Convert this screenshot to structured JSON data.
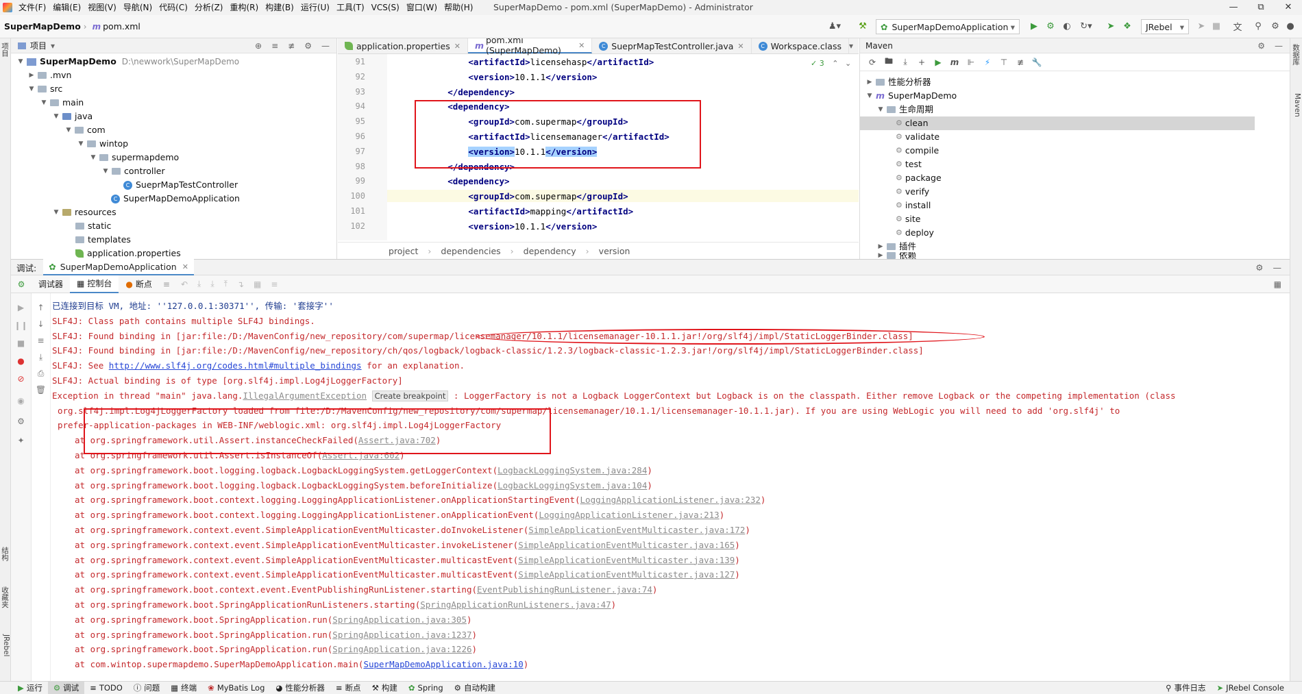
{
  "menubar": {
    "items": [
      "文件(F)",
      "编辑(E)",
      "视图(V)",
      "导航(N)",
      "代码(C)",
      "分析(Z)",
      "重构(R)",
      "构建(B)",
      "运行(U)",
      "工具(T)",
      "VCS(S)",
      "窗口(W)",
      "帮助(H)"
    ],
    "title": "SuperMapDemo - pom.xml (SuperMapDemo) - Administrator"
  },
  "navbar": {
    "project": "SuperMapDemo",
    "file": "pom.xml",
    "run_config": "SuperMapDemoApplication",
    "jrebel": "JRebel"
  },
  "left_stripe": {
    "project_tab": "项目",
    "structure_tab": "结构",
    "favorites_tab": "收藏夹",
    "jrebel_tab": "JRebel"
  },
  "right_stripe": {
    "db_tab": "数据库",
    "maven_tab": "Maven"
  },
  "project_panel": {
    "title": "项目",
    "root": "SuperMapDemo",
    "root_path": "D:\\newwork\\SuperMapDemo",
    "items": [
      ".mvn",
      "src",
      "main",
      "java",
      "com",
      "wintop",
      "supermapdemo",
      "controller",
      "SueprMapTestController",
      "SuperMapDemoApplication",
      "resources",
      "static",
      "templates",
      "application.properties"
    ]
  },
  "editor": {
    "tabs": [
      "application.properties",
      "pom.xml (SuperMapDemo)",
      "SueprMapTestController.java",
      "Workspace.class"
    ],
    "inspection_count": "3",
    "lines": [
      {
        "n": "91",
        "pre": "            ",
        "open": "<artifactId>",
        "text": "licensehasp",
        "close": "</artifactId>"
      },
      {
        "n": "92",
        "pre": "            ",
        "open": "<version>",
        "text": "10.1.1",
        "close": "</version>"
      },
      {
        "n": "93",
        "pre": "        ",
        "open": "</dependency>",
        "text": "",
        "close": ""
      },
      {
        "n": "94",
        "pre": "        ",
        "open": "<dependency>",
        "text": "",
        "close": ""
      },
      {
        "n": "95",
        "pre": "            ",
        "open": "<groupId>",
        "text": "com.supermap",
        "close": "</groupId>"
      },
      {
        "n": "96",
        "pre": "            ",
        "open": "<artifactId>",
        "text": "licensemanager",
        "close": "</artifactId>"
      },
      {
        "n": "97",
        "pre": "            ",
        "open": "<version>",
        "text": "10.1.1",
        "close": "</version>"
      },
      {
        "n": "98",
        "pre": "        ",
        "open": "</dependency>",
        "text": "",
        "close": ""
      },
      {
        "n": "99",
        "pre": "        ",
        "open": "<dependency>",
        "text": "",
        "close": ""
      },
      {
        "n": "100",
        "pre": "            ",
        "open": "<groupId>",
        "text": "com.supermap",
        "close": "</groupId>"
      },
      {
        "n": "101",
        "pre": "            ",
        "open": "<artifactId>",
        "text": "mapping",
        "close": "</artifactId>"
      },
      {
        "n": "102",
        "pre": "            ",
        "open": "<version>",
        "text": "10.1.1",
        "close": "</version>"
      }
    ],
    "breadcrumb": [
      "project",
      "dependencies",
      "dependency",
      "version"
    ]
  },
  "maven": {
    "title": "Maven",
    "nodes": {
      "profiles": "性能分析器",
      "project": "SuperMapDemo",
      "lifecycle": "生命周期",
      "phases": [
        "clean",
        "validate",
        "compile",
        "test",
        "package",
        "verify",
        "install",
        "site",
        "deploy"
      ],
      "plugins": "插件",
      "deps": "依赖"
    }
  },
  "debug": {
    "label": "调试:",
    "config": "SuperMapDemoApplication",
    "tabs": {
      "debugger": "调试器",
      "console": "控制台",
      "breakpoints": "断点"
    }
  },
  "console": {
    "connected": "已连接到目标 VM, 地址: ''127.0.0.1:30371'', 传输: '套接字''",
    "slf4j_1": "SLF4J: Class path contains multiple SLF4J bindings.",
    "slf4j_2": "SLF4J: Found binding in [jar:file:/D:/MavenConfig/new_repository/com/supermap/licensemanager/10.1.1/licensemanager-10.1.1.jar!/org/slf4j/impl/StaticLoggerBinder.class]",
    "slf4j_3": "SLF4J: Found binding in [jar:file:/D:/MavenConfig/new_repository/ch/qos/logback/logback-classic/1.2.3/logback-classic-1.2.3.jar!/org/slf4j/impl/StaticLoggerBinder.class]",
    "slf4j_4_pre": "SLF4J: See ",
    "slf4j_4_link": "http://www.slf4j.org/codes.html#multiple_bindings",
    "slf4j_4_post": " for an explanation.",
    "slf4j_5": "SLF4J: Actual binding is of type [org.slf4j.impl.Log4jLoggerFactory]",
    "exc_pre": "Exception in thread \"main\" java.lang.",
    "exc_class": "IllegalArgumentException",
    "exc_popup": "Create breakpoint",
    "exc_post": " : LoggerFactory is not a Logback LoggerContext but Logback is on the classpath. Either remove Logback or the competing implementation (class",
    "exc_line2": "org.slf4j.impl.Log4jLoggerFactory loaded from file:/D:/MavenConfig/new_repository/com/supermap/licensemanager/10.1.1/licensemanager-10.1.1.jar). If you are using WebLogic you will need to add 'org.slf4j' to",
    "exc_line3": "prefer-application-packages in WEB-INF/weblogic.xml: org.slf4j.impl.Log4jLoggerFactory",
    "stack": [
      {
        "m": "at org.springframework.util.Assert.instanceCheckFailed(",
        "l": "Assert.java:702",
        "blue": false
      },
      {
        "m": "at org.springframework.util.Assert.isInstanceOf(",
        "l": "Assert.java:602",
        "blue": false
      },
      {
        "m": "at org.springframework.boot.logging.logback.LogbackLoggingSystem.getLoggerContext(",
        "l": "LogbackLoggingSystem.java:284",
        "blue": false
      },
      {
        "m": "at org.springframework.boot.logging.logback.LogbackLoggingSystem.beforeInitialize(",
        "l": "LogbackLoggingSystem.java:104",
        "blue": false
      },
      {
        "m": "at org.springframework.boot.context.logging.LoggingApplicationListener.onApplicationStartingEvent(",
        "l": "LoggingApplicationListener.java:232",
        "blue": false
      },
      {
        "m": "at org.springframework.boot.context.logging.LoggingApplicationListener.onApplicationEvent(",
        "l": "LoggingApplicationListener.java:213",
        "blue": false
      },
      {
        "m": "at org.springframework.context.event.SimpleApplicationEventMulticaster.doInvokeListener(",
        "l": "SimpleApplicationEventMulticaster.java:172",
        "blue": false
      },
      {
        "m": "at org.springframework.context.event.SimpleApplicationEventMulticaster.invokeListener(",
        "l": "SimpleApplicationEventMulticaster.java:165",
        "blue": false
      },
      {
        "m": "at org.springframework.context.event.SimpleApplicationEventMulticaster.multicastEvent(",
        "l": "SimpleApplicationEventMulticaster.java:139",
        "blue": false
      },
      {
        "m": "at org.springframework.context.event.SimpleApplicationEventMulticaster.multicastEvent(",
        "l": "SimpleApplicationEventMulticaster.java:127",
        "blue": false
      },
      {
        "m": "at org.springframework.boot.context.event.EventPublishingRunListener.starting(",
        "l": "EventPublishingRunListener.java:74",
        "blue": false
      },
      {
        "m": "at org.springframework.boot.SpringApplicationRunListeners.starting(",
        "l": "SpringApplicationRunListeners.java:47",
        "blue": false
      },
      {
        "m": "at org.springframework.boot.SpringApplication.run(",
        "l": "SpringApplication.java:305",
        "blue": false
      },
      {
        "m": "at org.springframework.boot.SpringApplication.run(",
        "l": "SpringApplication.java:1237",
        "blue": false
      },
      {
        "m": "at org.springframework.boot.SpringApplication.run(",
        "l": "SpringApplication.java:1226",
        "blue": false
      },
      {
        "m": "at com.wintop.supermapdemo.SuperMapDemoApplication.main(",
        "l": "SuperMapDemoApplication.java:10",
        "blue": true
      }
    ]
  },
  "statusbar": {
    "items": [
      "运行",
      "调试",
      "TODO",
      "问题",
      "终端",
      "MyBatis Log",
      "性能分析器",
      "断点",
      "构建",
      "Spring",
      "自动构建"
    ],
    "right": [
      "事件日志",
      "JRebel Console"
    ]
  },
  "colors": {
    "accent": "#4a88c7",
    "error": "#c4282b",
    "annotation": "#e0141a"
  }
}
